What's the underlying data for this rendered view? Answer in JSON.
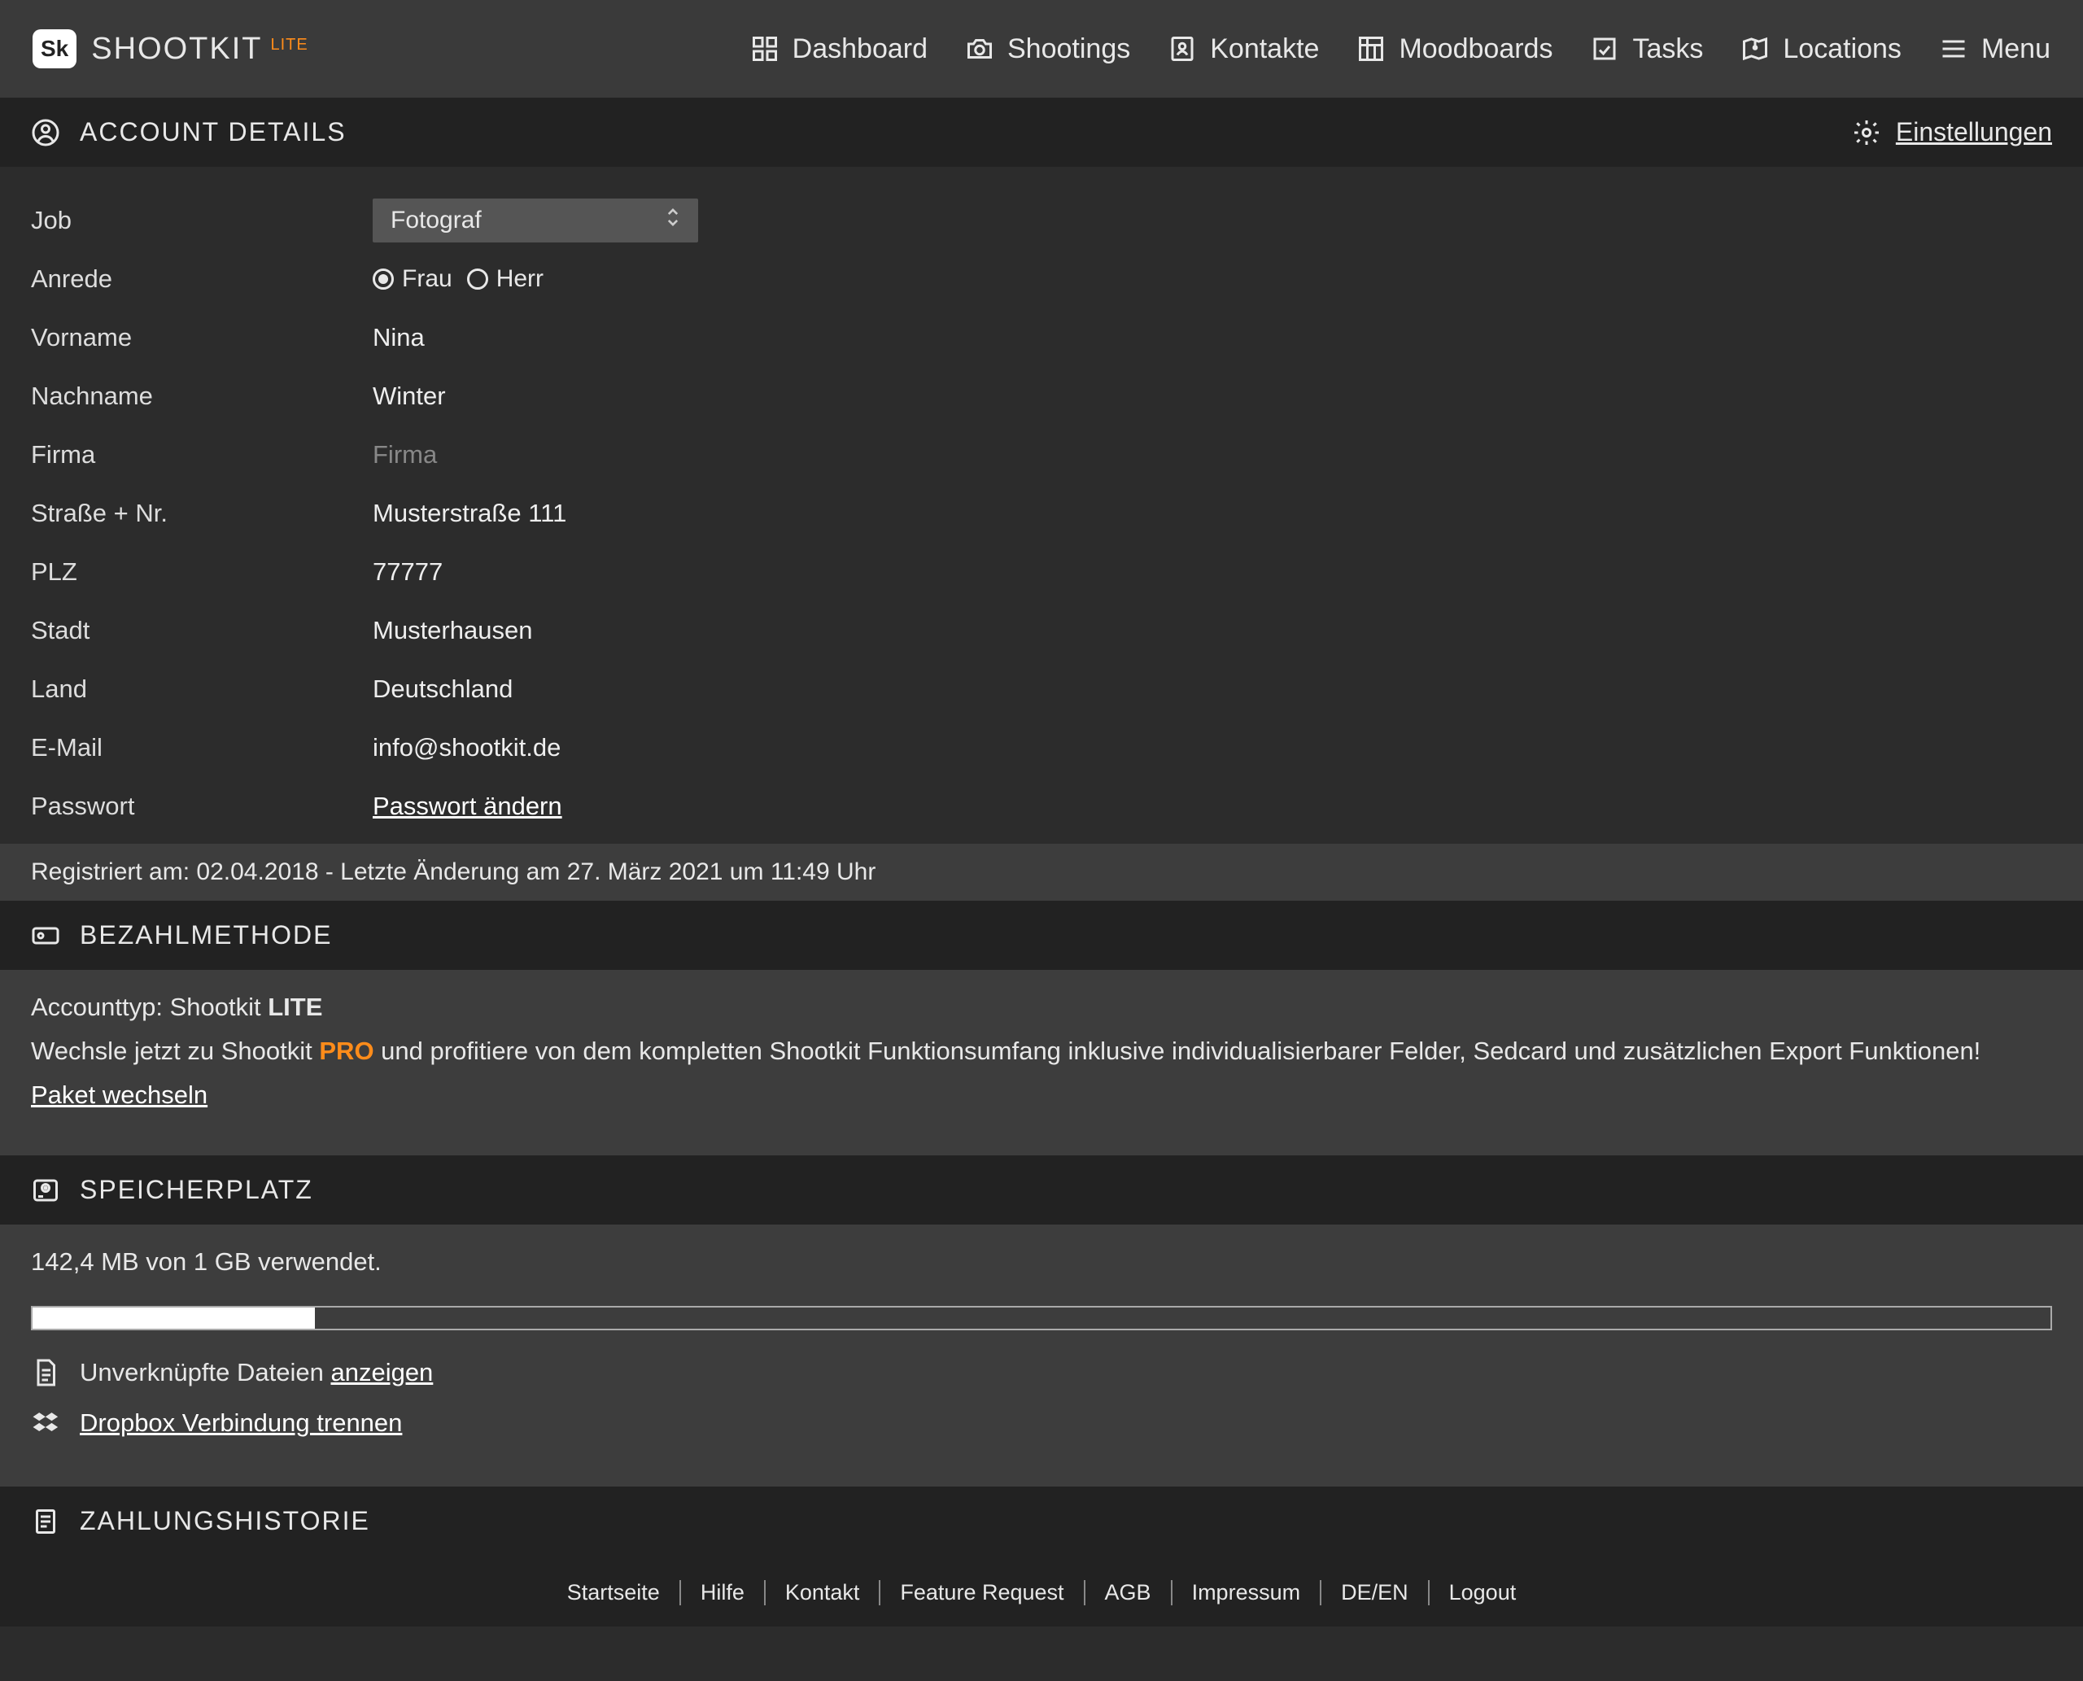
{
  "brand": {
    "logo": "Sk",
    "name": "SHOOTKIT",
    "tier": "LITE"
  },
  "nav": {
    "dashboard": "Dashboard",
    "shootings": "Shootings",
    "kontakte": "Kontakte",
    "moodboards": "Moodboards",
    "tasks": "Tasks",
    "locations": "Locations",
    "menu": "Menu"
  },
  "account": {
    "title": "ACCOUNT DETAILS",
    "settings": "Einstellungen",
    "fields": {
      "job_label": "Job",
      "job_value": "Fotograf",
      "anrede_label": "Anrede",
      "anrede_frau": "Frau",
      "anrede_herr": "Herr",
      "vorname_label": "Vorname",
      "vorname_value": "Nina",
      "nachname_label": "Nachname",
      "nachname_value": "Winter",
      "firma_label": "Firma",
      "firma_placeholder": "Firma",
      "strasse_label": "Straße + Nr.",
      "strasse_value": "Musterstraße 111",
      "plz_label": "PLZ",
      "plz_value": "77777",
      "stadt_label": "Stadt",
      "stadt_value": "Musterhausen",
      "land_label": "Land",
      "land_value": "Deutschland",
      "email_label": "E-Mail",
      "email_value": "info@shootkit.de",
      "passwort_label": "Passwort",
      "passwort_link": "Passwort ändern"
    },
    "meta": "Registriert am: 02.04.2018 - Letzte Änderung am 27. März 2021 um 11:49 Uhr"
  },
  "payment": {
    "title": "BEZAHLMETHODE",
    "account_type_prefix": "Accounttyp: Shootkit ",
    "account_type_tier": "LITE",
    "upsell_prefix": "Wechsle jetzt zu Shootkit ",
    "upsell_pro": "PRO",
    "upsell_suffix": " und profitiere von dem kompletten Shootkit Funktionsumfang inklusive individualisierbarer Felder, Sedcard und zusätzlichen Export Funktionen!",
    "change_link": "Paket wechseln"
  },
  "storage": {
    "title": "SPEICHERPLATZ",
    "usage_text": "142,4 MB von 1 GB verwendet.",
    "percent": 14,
    "unlinked_prefix": "Unverknüpfte Dateien ",
    "unlinked_link": "anzeigen",
    "dropbox_link": "Dropbox Verbindung trennen"
  },
  "history": {
    "title": "ZAHLUNGSHISTORIE"
  },
  "footer": {
    "startseite": "Startseite",
    "hilfe": "Hilfe",
    "kontakt": "Kontakt",
    "feature": "Feature Request",
    "agb": "AGB",
    "impressum": "Impressum",
    "lang": "DE/EN",
    "logout": "Logout"
  }
}
